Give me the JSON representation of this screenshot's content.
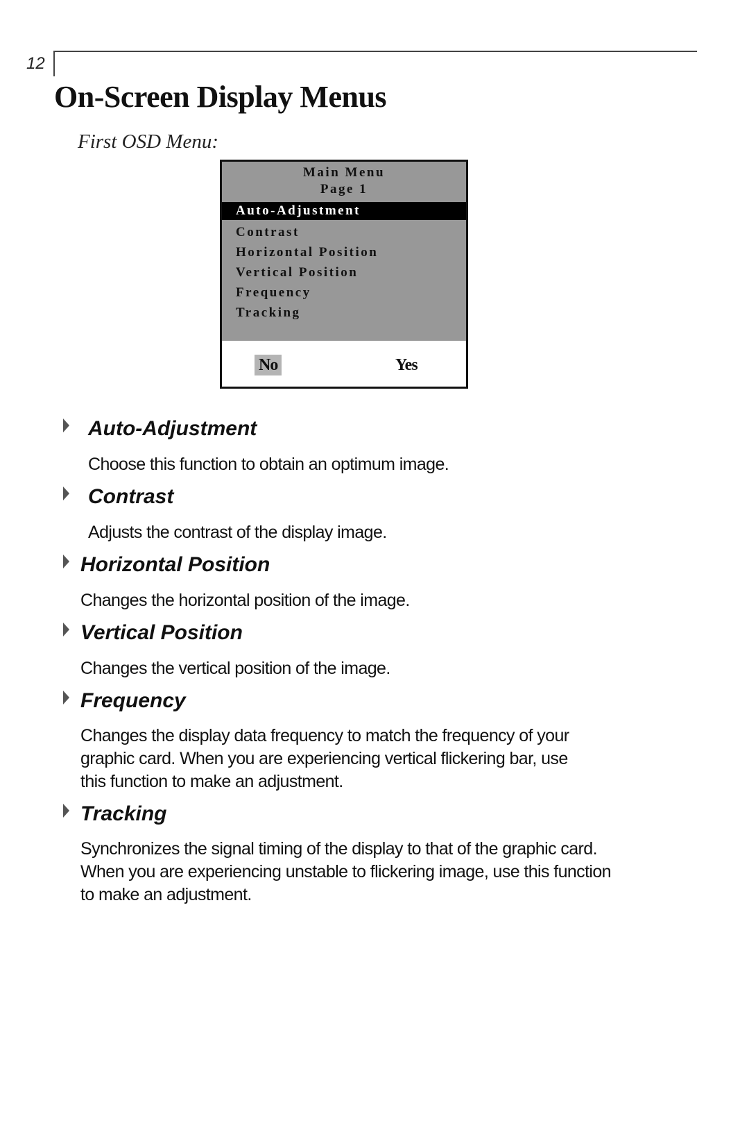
{
  "page": {
    "number": "12",
    "title": "On-Screen Display Menus",
    "subtitle": "First OSD Menu:"
  },
  "osd_menu": {
    "header_line1": "Main Menu",
    "header_line2": "Page 1",
    "items": [
      {
        "label": "Auto-Adjustment",
        "selected": true
      },
      {
        "label": "Contrast",
        "selected": false
      },
      {
        "label": "Horizontal Position",
        "selected": false
      },
      {
        "label": "Vertical Position",
        "selected": false
      },
      {
        "label": "Frequency",
        "selected": false
      },
      {
        "label": "Tracking",
        "selected": false
      }
    ],
    "no_label": "No",
    "yes_label": "Yes",
    "selected_option": "No"
  },
  "sections": [
    {
      "title": "Auto-Adjustment",
      "lines": [
        "Choose this function to obtain an optimum image."
      ]
    },
    {
      "title": "Contrast",
      "lines": [
        "Adjusts the contrast of the display image."
      ]
    },
    {
      "title": "Horizontal Position",
      "lines": [
        "Changes the horizontal position of the image."
      ]
    },
    {
      "title": "Vertical Position",
      "lines": [
        "Changes the vertical position of  the image."
      ]
    },
    {
      "title": "Frequency",
      "lines": [
        "Changes the display data frequency to match the frequency of your",
        "graphic card. When you are experiencing vertical flickering bar, use",
        "this function to make an adjustment."
      ]
    },
    {
      "title": "Tracking",
      "lines": [
        "Synchronizes the signal timing of the display to that of the graphic card.",
        "When you are experiencing unstable to flickering image, use this function",
        "to make an adjustment."
      ]
    }
  ],
  "colors": {
    "osd_background": "#989898",
    "osd_selected_bg": "#000000",
    "osd_no_highlight": "#b4b4b4",
    "bullet": "#555555"
  }
}
